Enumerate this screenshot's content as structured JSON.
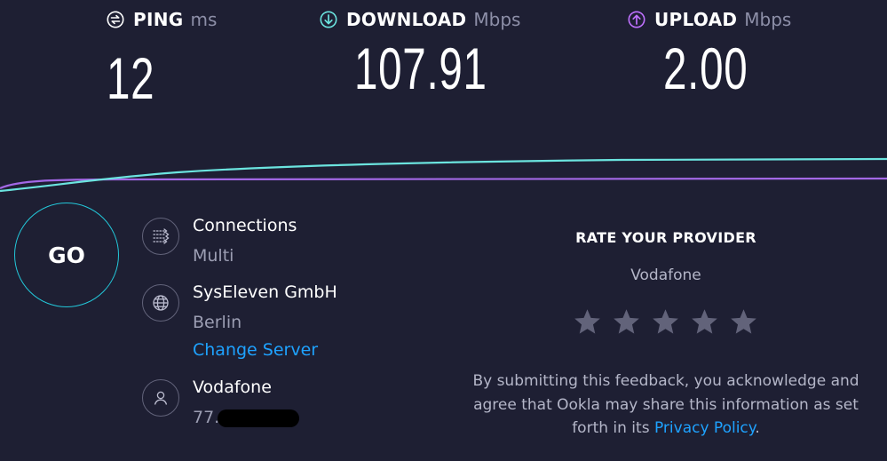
{
  "metrics": {
    "ping": {
      "label": "PING",
      "unit": "ms",
      "value": "12",
      "icon": "ping-icon",
      "color": "#ffffff"
    },
    "download": {
      "label": "DOWNLOAD",
      "unit": "Mbps",
      "value": "107.91",
      "icon": "download-arrow-icon",
      "color": "#6be4df"
    },
    "upload": {
      "label": "UPLOAD",
      "unit": "Mbps",
      "value": "2.00",
      "icon": "upload-arrow-icon",
      "color": "#bf71ff"
    }
  },
  "graph": {
    "download_color": "#6be4df",
    "upload_color": "#a368e6"
  },
  "go_button": {
    "label": "GO",
    "border_color": "#23c7d9"
  },
  "connections": {
    "title": "Connections",
    "value": "Multi",
    "icon": "connections-icon"
  },
  "server": {
    "title": "SysEleven GmbH",
    "location": "Berlin",
    "change_label": "Change Server",
    "icon": "globe-icon"
  },
  "provider": {
    "title": "Vodafone",
    "ip_visible": "77.",
    "icon": "user-icon"
  },
  "rating": {
    "heading": "RATE YOUR PROVIDER",
    "provider_name": "Vodafone",
    "stars_total": 5,
    "stars_selected": 0,
    "disclaimer_text": "By submitting this feedback, you acknowledge and agree that Ookla may share this information as set forth in its ",
    "privacy_label": "Privacy Policy",
    "disclaimer_end": "."
  },
  "colors": {
    "background": "#1e1f33",
    "link": "#1ea2ff",
    "star": "#62637a"
  }
}
